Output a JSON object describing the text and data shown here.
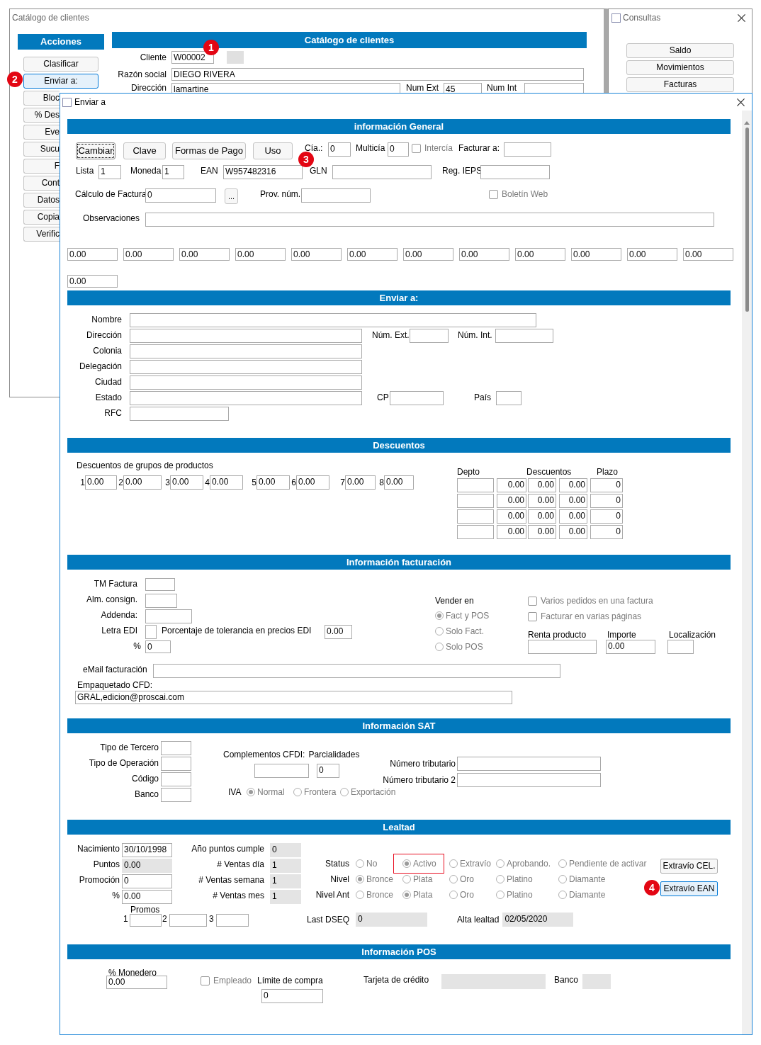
{
  "main_window": {
    "title": "Catálogo de clientes",
    "actions_header": "Acciones",
    "actions": [
      {
        "label": "Clasificar",
        "selected": false
      },
      {
        "label": "Enviar a:",
        "selected": true
      },
      {
        "label": "Bloc",
        "selected": false
      },
      {
        "label": "% Des",
        "selected": false
      },
      {
        "label": "Eve",
        "selected": false
      },
      {
        "label": "Sucu",
        "selected": false
      },
      {
        "label": "F",
        "selected": false
      },
      {
        "label": "Cont",
        "selected": false
      },
      {
        "label": "Datos",
        "selected": false
      },
      {
        "label": "Copia",
        "selected": false
      },
      {
        "label": "Verific",
        "selected": false
      }
    ],
    "catalog_header": "Catálogo de clientes",
    "cliente": {
      "label": "Cliente",
      "value": "W00002"
    },
    "razon_social": {
      "label": "Razón social",
      "value": "DIEGO RIVERA"
    },
    "direccion": {
      "label": "Dirección",
      "value": "lamartine",
      "num_ext_label": "Num Ext",
      "num_ext": "45",
      "num_int_label": "Num Int"
    }
  },
  "consultas_window": {
    "title": "Consultas",
    "buttons": [
      "Saldo",
      "Movimientos",
      "Facturas"
    ]
  },
  "dialog": {
    "title": "Enviar a",
    "general": {
      "header": "información General",
      "buttons": [
        {
          "label": "Cambiar",
          "focused": true
        },
        {
          "label": "Clave",
          "focused": false
        },
        {
          "label": "Formas de Pago",
          "focused": false
        },
        {
          "label": "Uso",
          "focused": false
        }
      ],
      "cia": {
        "label": "Cía.:",
        "value": "0"
      },
      "multicia": {
        "label": "Multicía",
        "value": "0"
      },
      "intercia": {
        "label": "Intercía",
        "checked": false
      },
      "facturar_a": {
        "label": "Facturar a:"
      },
      "lista": {
        "label": "Lista",
        "value": "1"
      },
      "moneda": {
        "label": "Moneda",
        "value": "1"
      },
      "ean": {
        "label": "EAN",
        "value": "W957482316"
      },
      "gln": {
        "label": "GLN"
      },
      "reg_ieps": {
        "label": "Reg. IEPS"
      },
      "calculo": {
        "label": "Cálculo de Factura",
        "value": "0"
      },
      "more_button": "...",
      "prov_num": {
        "label": "Prov. núm."
      },
      "boletin_web": {
        "label": "Boletín Web",
        "checked": false
      },
      "observaciones": {
        "label": "Observaciones"
      },
      "amounts": [
        "0.00",
        "0.00",
        "0.00",
        "0.00",
        "0.00",
        "0.00",
        "0.00",
        "0.00",
        "0.00",
        "0.00",
        "0.00",
        "0.00",
        "0.00"
      ]
    },
    "enviar": {
      "header": "Enviar a:",
      "nombre": {
        "label": "Nombre"
      },
      "direccion": {
        "label": "Dirección"
      },
      "num_ext": {
        "label": "Núm. Ext."
      },
      "num_int": {
        "label": "Núm. Int."
      },
      "colonia": {
        "label": "Colonia"
      },
      "delegacion": {
        "label": "Delegación"
      },
      "ciudad": {
        "label": "Ciudad"
      },
      "estado": {
        "label": "Estado"
      },
      "cp": {
        "label": "CP"
      },
      "pais": {
        "label": "País"
      },
      "rfc": {
        "label": "RFC"
      }
    },
    "descuentos": {
      "header": "Descuentos",
      "group_label": "Descuentos de grupos de productos",
      "groups": [
        {
          "number": "1",
          "value": "0.00"
        },
        {
          "number": "2",
          "value": "0.00"
        },
        {
          "number": "3",
          "value": "0.00"
        },
        {
          "number": "4",
          "value": "0.00"
        },
        {
          "number": "5",
          "value": "0.00"
        },
        {
          "number": "6",
          "value": "0.00"
        },
        {
          "number": "7",
          "value": "0.00"
        },
        {
          "number": "8",
          "value": "0.00"
        }
      ],
      "table": {
        "columns": [
          "Depto",
          "Descuentos",
          "Plazo"
        ],
        "rows": [
          {
            "descuentos": [
              "0.00",
              "0.00",
              "0.00"
            ],
            "plazo": "0"
          },
          {
            "descuentos": [
              "0.00",
              "0.00",
              "0.00"
            ],
            "plazo": "0"
          },
          {
            "descuentos": [
              "0.00",
              "0.00",
              "0.00"
            ],
            "plazo": "0"
          },
          {
            "descuentos": [
              "0.00",
              "0.00",
              "0.00"
            ],
            "plazo": "0"
          }
        ]
      }
    },
    "facturacion": {
      "header": "Información facturación",
      "tm_factura": {
        "label": "TM Factura"
      },
      "alm_consign": {
        "label": "Alm. consign."
      },
      "addenda": {
        "label": "Addenda:"
      },
      "letra_edi": {
        "label": "Letra EDI"
      },
      "tolerancia": {
        "label": "Porcentaje de tolerancia en precios EDI",
        "value": "0.00"
      },
      "porcentaje": {
        "label": "%",
        "value": "0"
      },
      "vender_en": {
        "label": "Vender en",
        "options": [
          {
            "label": "Fact y POS",
            "selected": true
          },
          {
            "label": "Solo Fact.",
            "selected": false
          },
          {
            "label": "Solo POS",
            "selected": false
          }
        ]
      },
      "checks": [
        {
          "label": "Varios pedidos en una factura",
          "checked": false
        },
        {
          "label": "Facturar en varias páginas",
          "checked": false
        }
      ],
      "renta_producto": {
        "label": "Renta producto"
      },
      "importe": {
        "label": "Importe",
        "value": "0.00"
      },
      "localizacion": {
        "label": "Localización"
      },
      "email": {
        "label": "eMail facturación"
      },
      "empaquetado": {
        "label": "Empaquetado CFD:",
        "value": "GRAL,edicion@proscai.com"
      }
    },
    "sat": {
      "header": "Información SAT",
      "fields": [
        {
          "label": "Tipo de Tercero"
        },
        {
          "label": "Tipo de Operación"
        },
        {
          "label": "Código"
        },
        {
          "label": "Banco"
        }
      ],
      "complementos": {
        "label": "Complementos CFDI:"
      },
      "parcialidades": {
        "label": "Parcialidades",
        "value": "0"
      },
      "tributarios": [
        {
          "label": "Número tributario"
        },
        {
          "label": "Número tributario 2"
        }
      ],
      "iva": {
        "label": "IVA",
        "options": [
          {
            "label": "Normal",
            "selected": true
          },
          {
            "label": "Frontera",
            "selected": false
          },
          {
            "label": "Exportación",
            "selected": false
          }
        ]
      }
    },
    "lealtad": {
      "header": "Lealtad",
      "left": [
        {
          "label": "Nacimiento",
          "value": "30/10/1998",
          "readonly": false
        },
        {
          "label": "Puntos",
          "value": "0.00",
          "readonly": true
        },
        {
          "label": "Promoción",
          "value": "0",
          "readonly": false
        },
        {
          "label": "%",
          "value": "0.00",
          "readonly": false
        }
      ],
      "promos": {
        "label": "Promos",
        "numbers": [
          "1",
          "2",
          "3"
        ]
      },
      "counters": [
        {
          "label": "Año puntos cumple",
          "value": "0"
        },
        {
          "label": "# Ventas día",
          "value": "1"
        },
        {
          "label": "# Ventas semana",
          "value": "1"
        },
        {
          "label": "# Ventas mes",
          "value": "1"
        }
      ],
      "radio_groups": [
        {
          "label": "Status",
          "options": [
            {
              "label": "No",
              "selected": false,
              "highlighted": false
            },
            {
              "label": "Activo",
              "selected": true,
              "highlighted": true
            },
            {
              "label": "Extravío",
              "selected": false,
              "highlighted": false
            },
            {
              "label": "Aprobando.",
              "selected": false,
              "highlighted": false
            },
            {
              "label": "Pendiente de activar",
              "selected": false,
              "highlighted": false
            }
          ]
        },
        {
          "label": "Nivel",
          "options": [
            {
              "label": "Bronce",
              "selected": true
            },
            {
              "label": "Plata",
              "selected": false
            },
            {
              "label": "Oro",
              "selected": false
            },
            {
              "label": "Platino",
              "selected": false
            },
            {
              "label": "Diamante",
              "selected": false
            }
          ]
        },
        {
          "label": "Nivel Ant",
          "options": [
            {
              "label": "Bronce",
              "selected": false
            },
            {
              "label": "Plata",
              "selected": true
            },
            {
              "label": "Oro",
              "selected": false
            },
            {
              "label": "Platino",
              "selected": false
            },
            {
              "label": "Diamante",
              "selected": false
            }
          ]
        }
      ],
      "buttons": [
        {
          "label": "Extravío CEL.",
          "focused": false
        },
        {
          "label": "Extravío EAN",
          "focused": true
        }
      ],
      "last_dseq": {
        "label": "Last DSEQ",
        "value": "0"
      },
      "alta_lealtad": {
        "label": "Alta lealtad",
        "value": "02/05/2020"
      }
    },
    "pos": {
      "header": "Información POS",
      "monedero": {
        "label": "% Monedero",
        "value": "0.00"
      },
      "empleado": {
        "label": "Empleado",
        "checked": false
      },
      "limite": {
        "label": "Límite de compra",
        "value": "0"
      },
      "tarjeta": {
        "label": "Tarjeta de crédito"
      },
      "banco": {
        "label": "Banco"
      }
    }
  },
  "markers": [
    "1",
    "2",
    "3",
    "4"
  ]
}
